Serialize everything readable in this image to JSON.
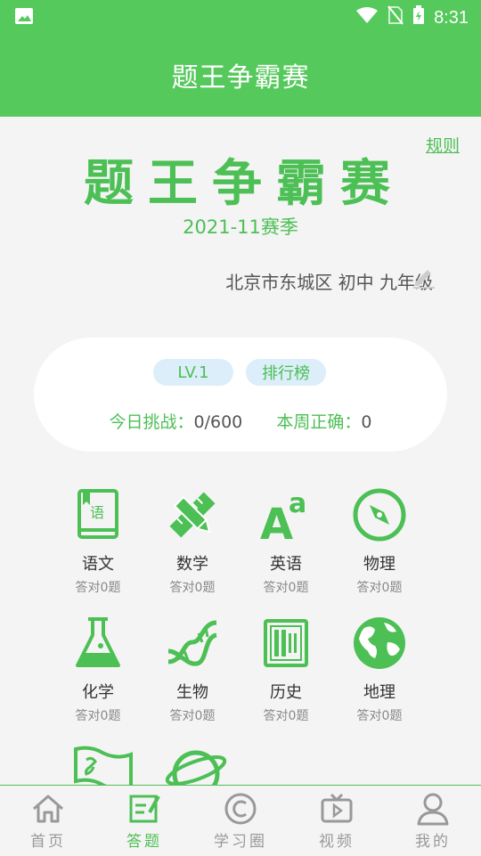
{
  "status_bar": {
    "time": "8:31"
  },
  "app_bar": {
    "title": "题王争霸赛"
  },
  "header": {
    "rules_link": "规则",
    "big_title": "题王争霸赛",
    "season": "2021-11赛季",
    "location": "北京市东城区 初中 九年级"
  },
  "card": {
    "level": "LV.1",
    "leaderboard": "排行榜",
    "today_label": "今日挑战：",
    "today_value": "0/600",
    "week_label": "本周正确：",
    "week_value": "0"
  },
  "subjects": [
    {
      "name": "语文",
      "sub": "答对0题",
      "icon": "book-icon"
    },
    {
      "name": "数学",
      "sub": "答对0题",
      "icon": "ruler-pencil-icon"
    },
    {
      "name": "英语",
      "sub": "答对0题",
      "icon": "letter-a-icon"
    },
    {
      "name": "物理",
      "sub": "答对0题",
      "icon": "compass-icon"
    },
    {
      "name": "化学",
      "sub": "答对0题",
      "icon": "flask-icon"
    },
    {
      "name": "生物",
      "sub": "答对0题",
      "icon": "dna-icon"
    },
    {
      "name": "历史",
      "sub": "答对0题",
      "icon": "abacus-icon"
    },
    {
      "name": "地理",
      "sub": "答对0题",
      "icon": "globe-icon"
    }
  ],
  "partial_subject_icons": [
    "flag-icon",
    "planet-icon"
  ],
  "bottom_nav": [
    {
      "label": "首页",
      "icon": "home-icon"
    },
    {
      "label": "答题",
      "icon": "edit-note-icon",
      "active": true
    },
    {
      "label": "学习圈",
      "icon": "copyright-circle-icon"
    },
    {
      "label": "视频",
      "icon": "tv-play-icon"
    },
    {
      "label": "我的",
      "icon": "user-icon"
    }
  ],
  "colors": {
    "primary": "#55c95c",
    "accent_text": "#4cbf55",
    "pill_bg": "#dbeef9"
  }
}
